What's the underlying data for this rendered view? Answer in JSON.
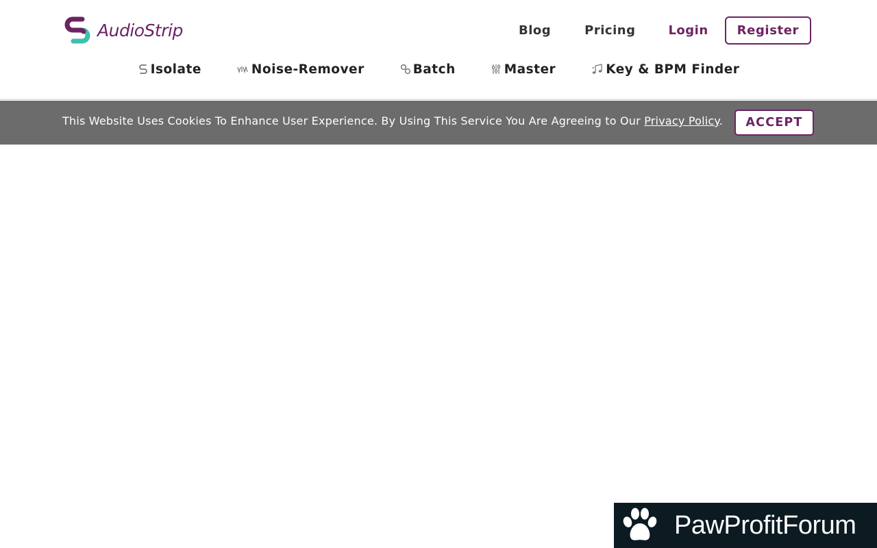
{
  "brand": {
    "name": "AudioStrip",
    "primary_color": "#6d2363",
    "accent_color": "#3fbfad",
    "logo_icon": "s-logo-icon"
  },
  "topnav": {
    "blog": "Blog",
    "pricing": "Pricing",
    "login": "Login",
    "register": "Register"
  },
  "toolnav": [
    {
      "label": "Isolate",
      "icon": "isolate-icon"
    },
    {
      "label": "Noise-Remover",
      "icon": "noise-wave-icon"
    },
    {
      "label": "Batch",
      "icon": "batch-link-icon"
    },
    {
      "label": "Master",
      "icon": "master-sliders-icon"
    },
    {
      "label": "Key & BPM Finder",
      "icon": "music-note-icon"
    }
  ],
  "cookie": {
    "text": "This Website Uses Cookies To Enhance User Experience. By Using This Service You Are Agreeing to Our ",
    "link": "Privacy Policy",
    "suffix": ".",
    "accept": "ACCEPT",
    "bar_color": "#6c6c6c"
  },
  "watermark": {
    "text": "PawProfitForum",
    "icon": "paw-icon"
  }
}
